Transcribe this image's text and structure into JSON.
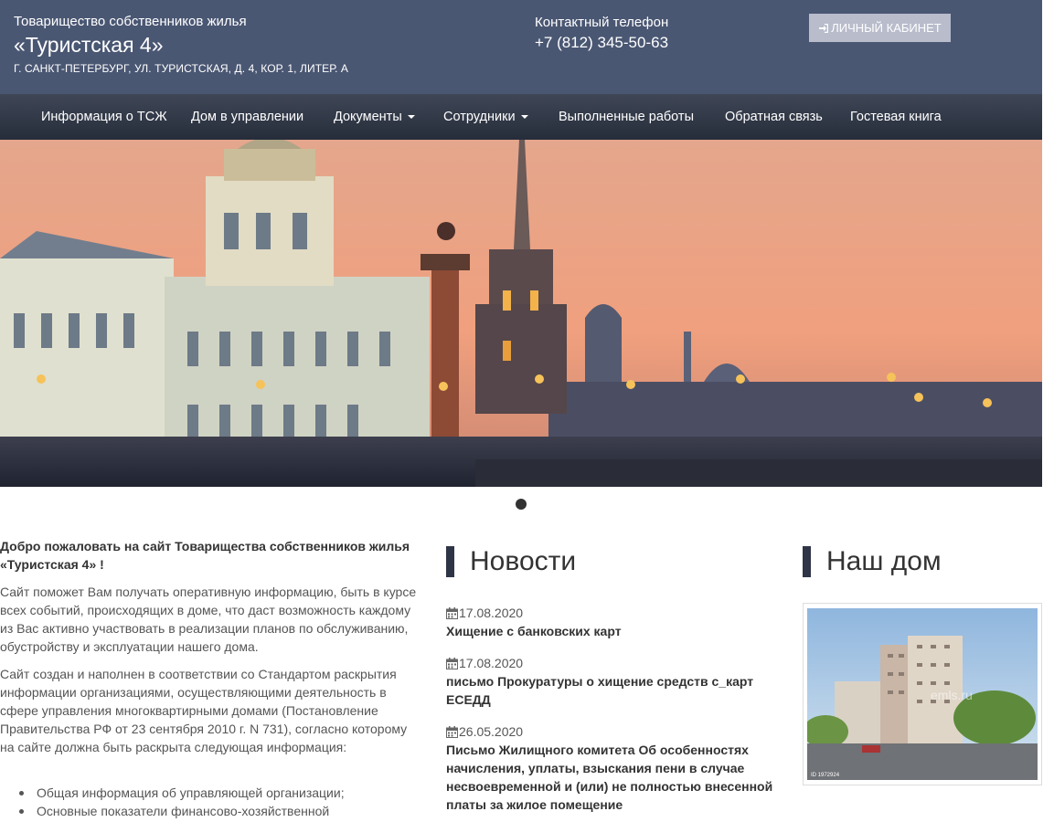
{
  "header": {
    "org_line1": "Товарищество собственников жилья",
    "org_name": "«Туристская 4»",
    "address": "Г. САНКТ-ПЕТЕРБУРГ, УЛ. ТУРИСТСКАЯ, Д. 4, КОР. 1, ЛИТЕР. А",
    "phone_label": "Контактный телефон",
    "phone": "+7 (812) 345-50-63",
    "cabinet_button": "ЛИЧНЫЙ КАБИНЕТ",
    "cabinet_icon": "sign-in-icon"
  },
  "nav": {
    "items": [
      {
        "label": "Информация о ТСЖ",
        "dropdown": false
      },
      {
        "label": "Дом в управлении",
        "dropdown": false
      },
      {
        "label": "Документы",
        "dropdown": true
      },
      {
        "label": "Сотрудники",
        "dropdown": true
      },
      {
        "label": "Выполненные работы",
        "dropdown": false
      },
      {
        "label": "Обратная связь",
        "dropdown": false
      },
      {
        "label": "Гостевая книга",
        "dropdown": false
      }
    ]
  },
  "welcome": {
    "title": "Добро пожаловать на сайт Товарищества собственников жилья «Туристская 4» !",
    "p1": "Сайт поможет Вам получать оперативную информацию, быть в курсе всех событий, происходящих в доме, что даст возможность каждому из Вас активно участвовать в реализации планов по обслуживанию, обустройству и эксплуатации нашего дома.",
    "p2": "Сайт создан и наполнен в соответствии со Стандартом раскрытия информации организациями, осуществляющими деятельность в сфере управления многоквартирными домами (Постановление Правительства РФ от 23 сентября 2010 г. N 731), согласно которому на сайте должна быть раскрыта следующая информация:",
    "bullets": [
      "Общая информация об управляющей организации;",
      "Основные показатели финансово-хозяйственной"
    ]
  },
  "news": {
    "heading": "Новости",
    "date_icon": "calendar-icon",
    "items": [
      {
        "date": "17.08.2020",
        "title": "Хищение с банковских карт"
      },
      {
        "date": "17.08.2020",
        "title": "письмо Прокуратуры о хищение средств с_карт ЕСЕДД"
      },
      {
        "date": "26.05.2020",
        "title": "Письмо Жилищного комитета Об особенностях начисления, уплаты, взыскания пени в случае несвоевременной и (или) не полностью внесенной платы за жилое помещение"
      }
    ]
  },
  "house": {
    "heading": "Наш дом",
    "watermark": "emls.ru",
    "photo_id": "ID 1972924"
  },
  "colors": {
    "header_bg": "#4a5773",
    "nav_bg": "#2b3240",
    "accent_bar": "#2e3547",
    "button_bg": "#b8bccb"
  }
}
